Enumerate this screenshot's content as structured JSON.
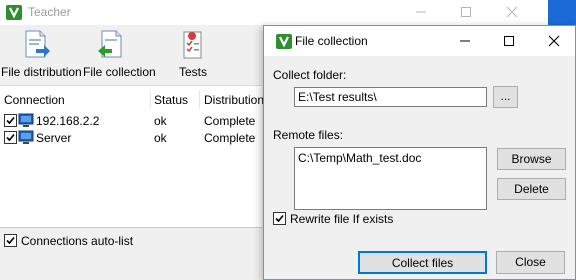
{
  "main_window": {
    "title": "Teacher",
    "toolbar": {
      "file_distribution": "File distribution",
      "file_collection": "File collection",
      "tests": "Tests"
    },
    "connections": {
      "columns": [
        "Connection",
        "Status",
        "Distribution"
      ],
      "rows": [
        {
          "name": "192.168.2.2",
          "status": "ok",
          "distribution": "Complete",
          "checked": true
        },
        {
          "name": "Server",
          "status": "ok",
          "distribution": "Complete",
          "checked": true
        }
      ]
    },
    "auto_list": {
      "label": "Connections auto-list",
      "checked": true
    }
  },
  "dialog": {
    "title": "File collection",
    "collect_folder": {
      "label": "Collect folder:",
      "value": "E:\\Test results\\",
      "browse_label": "..."
    },
    "remote_files": {
      "label": "Remote files:",
      "items": [
        "C:\\Temp\\Math_test.doc"
      ]
    },
    "buttons": {
      "browse": "Browse",
      "delete": "Delete",
      "collect": "Collect files",
      "close": "Close"
    },
    "rewrite": {
      "label": "Rewrite file If exists",
      "checked": true
    }
  },
  "colors": {
    "accent": "#0078d7",
    "taskbar_edge": "#1b6ad6",
    "app_icon_green": "#3a9b3a"
  }
}
